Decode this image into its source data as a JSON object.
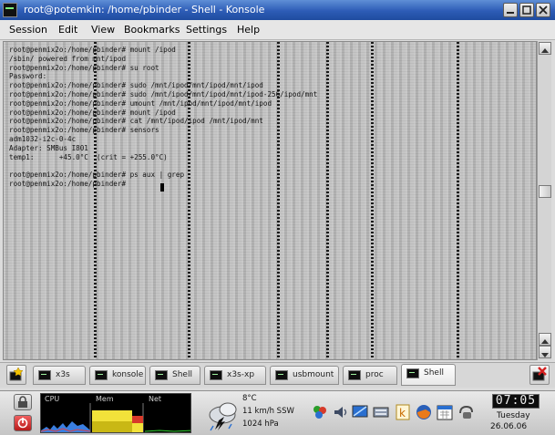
{
  "window": {
    "title": "root@potemkin: /home/pbinder - Shell - Konsole"
  },
  "menubar": {
    "items": [
      "Session",
      "Edit",
      "View",
      "Bookmarks",
      "Settings",
      "Help"
    ]
  },
  "terminal": {
    "lines": [
      "root@penmix2o:/home/pbinder# mount /ipod",
      "/sbin/ powered from mnt/ipod",
      "root@penmix2o:/home/pbinder# su root",
      "Password:",
      "root@penmix2o:/home/pbinder# sudo /mnt/ipod/mnt/ipod/mnt/ipod",
      "root@penmix2o:/home/pbinder# sudo /mnt/ipod/mnt/ipod/mnt/ipod-256/ipod/mnt",
      "root@penmix2o:/home/pbinder# umount /mnt/ipod/mnt/ipod/mnt/ipod",
      "root@penmix2o:/home/pbinder# mount /ipod",
      "root@penmix2o:/home/pbinder# cat /mnt/ipod/ipod /mnt/ipod/mnt",
      "root@penmix2o:/home/pbinder# sensors",
      "adm1032-i2c-0-4c",
      "Adapter: SMBus I801",
      "temp1:      +45.0°C  (crit = +255.0°C)",
      "",
      "root@penmix2o:/home/pbinder# ps aux | grep",
      "root@penmix2o:/home/pbinder# "
    ]
  },
  "tabs": [
    {
      "label": "x3s"
    },
    {
      "label": "konsole"
    },
    {
      "label": "Shell"
    },
    {
      "label": "x3s-xp"
    },
    {
      "label": "usbmount"
    },
    {
      "label": "proc"
    },
    {
      "label": "Shell"
    }
  ],
  "active_tab_index": 6,
  "panel": {
    "sysmon": {
      "labels": [
        "CPU",
        "Mem",
        "Net"
      ]
    },
    "weather": {
      "lines": [
        "8°C",
        "11 km/h SSW",
        "1024 hPa"
      ]
    },
    "tray_icons": [
      "network-icon",
      "volume-icon",
      "display-icon",
      "keyboard-icon",
      "klipper-icon",
      "firefox-icon",
      "calendar-icon",
      "updates-icon"
    ],
    "clock": {
      "time": "07:05",
      "day": "Tuesday",
      "date": "26.06.06"
    }
  },
  "colors": {
    "titlebar": "#2d5cb6",
    "terminal_bg": "#bdbdbd",
    "cpu_graph": "#f2e23a",
    "panel_bg": "#d4d4d4"
  }
}
